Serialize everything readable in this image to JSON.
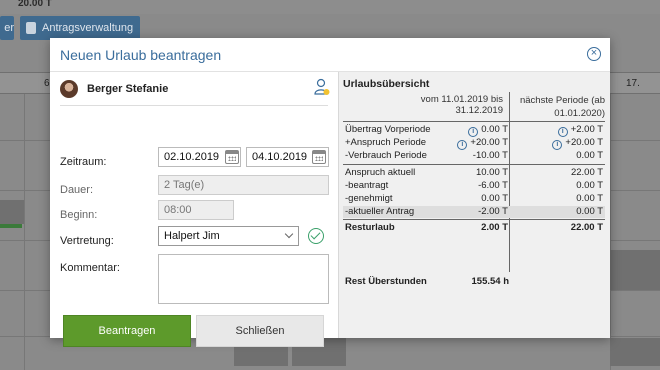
{
  "background": {
    "top_value": "20.00 T",
    "tab1_label": "er",
    "tab2_label": "Antragsverwaltung",
    "col_header_left": "6",
    "col_header_right": "17."
  },
  "dialog": {
    "title": "Neuen Urlaub beantragen",
    "user_name": "Berger Stefanie",
    "labels": {
      "zeitraum": "Zeitraum:",
      "dauer": "Dauer:",
      "beginn": "Beginn:",
      "vertretung": "Vertretung:",
      "kommentar": "Kommentar:"
    },
    "fields": {
      "date_from": "02.10.2019",
      "date_to": "04.10.2019",
      "dauer": "2 Tag(e)",
      "beginn": "08:00",
      "vertretung": "Halpert Jim",
      "kommentar": ""
    },
    "buttons": {
      "submit": "Beantragen",
      "close": "Schließen"
    }
  },
  "overview": {
    "title": "Urlaubsübersicht",
    "period_current": "vom 11.01.2019 bis 31.12.2019",
    "period_next": "nächste Periode (ab 01.01.2020)",
    "rows": [
      {
        "label": "Übertrag Vorperiode",
        "current": "0.00 T",
        "next": "+2.00 T"
      },
      {
        "label": "+Anspruch Periode",
        "current": "+20.00 T",
        "next": "+20.00 T"
      },
      {
        "label": "-Verbrauch Periode",
        "current": "-10.00 T",
        "next": "0.00 T"
      },
      {
        "label": "Anspruch aktuell",
        "current": "10.00 T",
        "next": "22.00 T"
      },
      {
        "label": "-beantragt",
        "current": "-6.00 T",
        "next": "0.00 T"
      },
      {
        "label": "-genehmigt",
        "current": "0.00 T",
        "next": "0.00 T"
      },
      {
        "label": "-aktueller Antrag",
        "current": "-2.00 T",
        "next": "0.00 T"
      },
      {
        "label": "Resturlaub",
        "current": "2.00 T",
        "next": "22.00 T"
      }
    ],
    "rest_label": "Rest Überstunden",
    "rest_value": "155.54 h"
  }
}
